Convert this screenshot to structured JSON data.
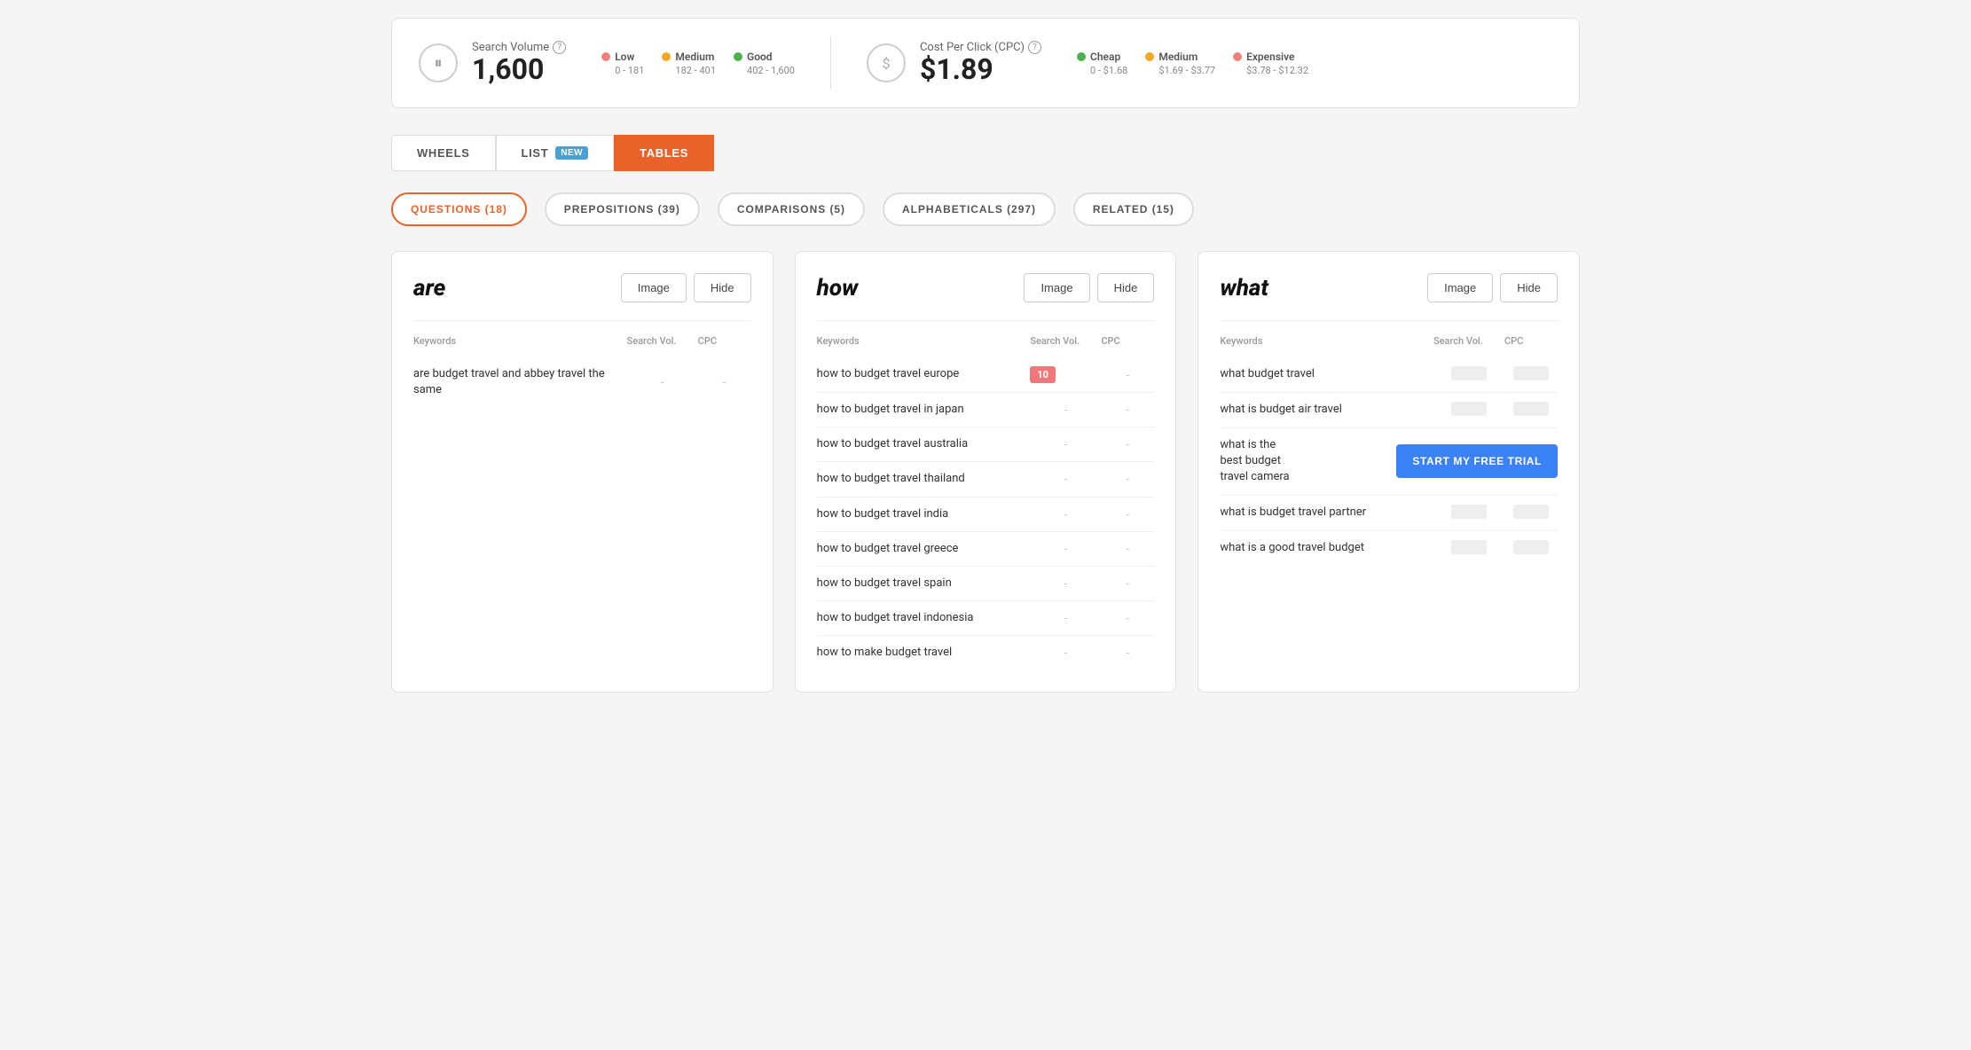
{
  "stats": {
    "searchVolume": {
      "icon": "⏸",
      "label": "Search Volume",
      "value": "1,600",
      "legend": [
        {
          "label": "Low",
          "range": "0 - 181",
          "color": "#f08080"
        },
        {
          "label": "Medium",
          "range": "182 - 401",
          "color": "#f5a623"
        },
        {
          "label": "Good",
          "range": "402 - 1,600",
          "color": "#4caf50"
        }
      ]
    },
    "cpc": {
      "icon": "$",
      "label": "Cost Per Click (CPC)",
      "value": "$1.89",
      "legend": [
        {
          "label": "Cheap",
          "range": "0 - $1.68",
          "color": "#4caf50"
        },
        {
          "label": "Medium",
          "range": "$1.69 - $3.77",
          "color": "#f5a623"
        },
        {
          "label": "Expensive",
          "range": "$3.78 - $12.32",
          "color": "#f08080"
        }
      ]
    }
  },
  "tabs": [
    {
      "id": "wheels",
      "label": "WHEELS",
      "active": false
    },
    {
      "id": "list",
      "label": "LIST",
      "badge": "NEW",
      "active": false
    },
    {
      "id": "tables",
      "label": "TABLES",
      "active": true
    }
  ],
  "filters": [
    {
      "id": "questions",
      "label": "QUESTIONS (18)",
      "active": true
    },
    {
      "id": "prepositions",
      "label": "PREPOSITIONS (39)",
      "active": false
    },
    {
      "id": "comparisons",
      "label": "COMPARISONS (5)",
      "active": false
    },
    {
      "id": "alphabeticals",
      "label": "ALPHABETICALS (297)",
      "active": false
    },
    {
      "id": "related",
      "label": "RELATED (15)",
      "active": false
    }
  ],
  "cards": [
    {
      "id": "are-card",
      "title": "are",
      "actions": [
        "Image",
        "Hide"
      ],
      "columns": [
        "Keywords",
        "Search Vol.",
        "CPC"
      ],
      "keywords": [
        {
          "text": "are budget travel and abbey travel the same",
          "vol": "-",
          "cpc": "-"
        }
      ]
    },
    {
      "id": "how-card",
      "title": "how",
      "actions": [
        "Image",
        "Hide"
      ],
      "columns": [
        "Keywords",
        "Search Vol.",
        "CPC"
      ],
      "keywords": [
        {
          "text": "how to budget travel europe",
          "vol": "10",
          "volHighlight": true,
          "cpc": "-"
        },
        {
          "text": "how to budget travel in japan",
          "vol": "-",
          "cpc": "-"
        },
        {
          "text": "how to budget travel australia",
          "vol": "-",
          "cpc": "-"
        },
        {
          "text": "how to budget travel thailand",
          "vol": "-",
          "cpc": "-"
        },
        {
          "text": "how to budget travel india",
          "vol": "-",
          "cpc": "-"
        },
        {
          "text": "how to budget travel greece",
          "vol": "-",
          "cpc": "-"
        },
        {
          "text": "how to budget travel spain",
          "vol": "-",
          "cpc": "-"
        },
        {
          "text": "how to budget travel indonesia",
          "vol": "-",
          "cpc": "-"
        },
        {
          "text": "how to make budget travel",
          "vol": "-",
          "cpc": "-"
        }
      ]
    },
    {
      "id": "what-card",
      "title": "what",
      "actions": [
        "Image",
        "Hide"
      ],
      "columns": [
        "Keywords",
        "Search Vol.",
        "CPC"
      ],
      "keywords": [
        {
          "text": "what budget travel",
          "vol": "",
          "cpc": ""
        },
        {
          "text": "what is budget air travel",
          "vol": "",
          "cpc": ""
        },
        {
          "text": "what is the best budget travel camera",
          "vol": "",
          "cpc": "",
          "showCta": true,
          "ctaLabel": "START MY FREE TRIAL"
        },
        {
          "text": "what is budget travel partner",
          "vol": "",
          "cpc": ""
        },
        {
          "text": "what is a good travel budget",
          "vol": "",
          "cpc": ""
        }
      ]
    }
  ]
}
